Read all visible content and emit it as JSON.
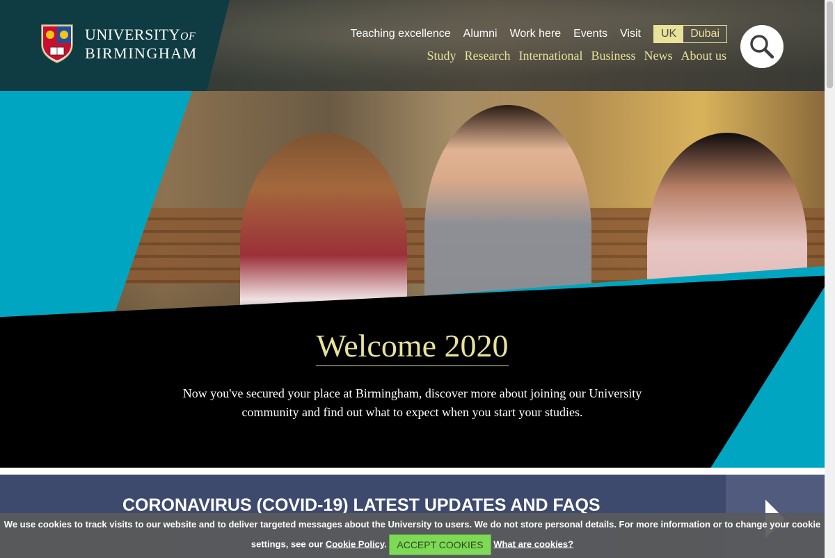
{
  "brand": {
    "line1": "UNIVERSITY",
    "of": "OF",
    "line2": "BIRMINGHAM",
    "accent_color": "#e8e29a",
    "teal_color": "#00a6c1"
  },
  "nav_secondary": [
    {
      "label": "Teaching excellence"
    },
    {
      "label": "Alumni"
    },
    {
      "label": "Work here"
    },
    {
      "label": "Events"
    },
    {
      "label": "Visit"
    }
  ],
  "campus_switch": {
    "uk": "UK",
    "dubai": "Dubai",
    "selected": "UK"
  },
  "nav_primary": [
    {
      "label": "Study"
    },
    {
      "label": "Research"
    },
    {
      "label": "International"
    },
    {
      "label": "Business"
    },
    {
      "label": "News"
    },
    {
      "label": "About us"
    }
  ],
  "search": {
    "icon": "search-icon"
  },
  "hero": {
    "title": "Welcome 2020",
    "text": "Now you've secured your place at Birmingham, discover more about joining our University community and find out what to expect when you start your studies."
  },
  "covid": {
    "title": "CORONAVIRUS (COVID-19) LATEST UPDATES AND FAQS",
    "icon": "chevron-right-icon"
  },
  "cookie": {
    "text_before": "We use cookies to track visits to our website and to deliver targeted messages about the University to users. We do not store personal details. For more information or to change your cookie settings, see our",
    "policy_link": "Cookie Policy",
    "period": ".",
    "accept_label": "ACCEPT COOKIES",
    "what_link": "What are cookies?"
  }
}
